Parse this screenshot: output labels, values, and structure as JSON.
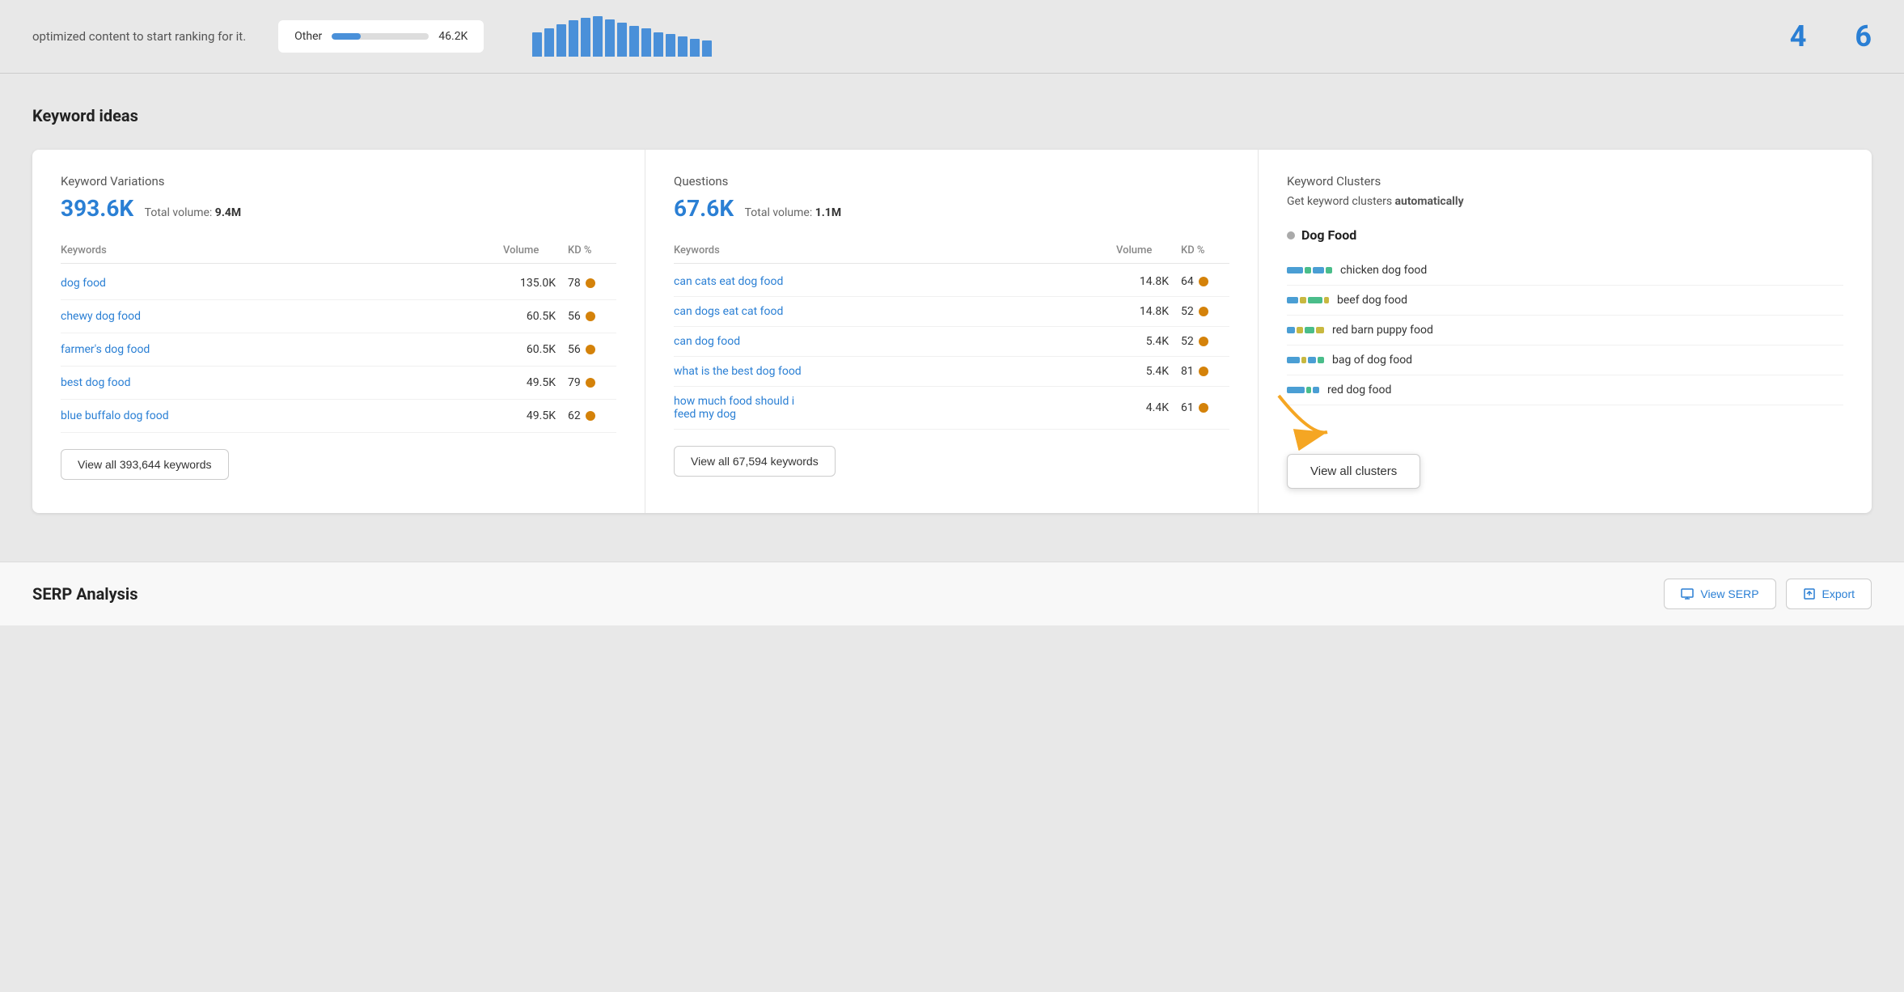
{
  "topBar": {
    "text": "optimized content to start ranking for it.",
    "other": {
      "label": "Other",
      "value": "46.2K",
      "progressPercent": 30
    },
    "chartBars": [
      60,
      70,
      75,
      80,
      85,
      90,
      88,
      82,
      78,
      72,
      65,
      60,
      55,
      50,
      45
    ],
    "numbers": [
      "4",
      "6"
    ]
  },
  "keywordIdeas": {
    "title": "Keyword ideas",
    "variations": {
      "subtitle": "Keyword Variations",
      "count": "393.6K",
      "totalVolumeLabel": "Total volume:",
      "totalVolume": "9.4M",
      "tableHeaders": [
        "Keywords",
        "Volume",
        "KD %"
      ],
      "rows": [
        {
          "keyword": "dog food",
          "volume": "135.0K",
          "kd": "78"
        },
        {
          "keyword": "chewy dog food",
          "volume": "60.5K",
          "kd": "56"
        },
        {
          "keyword": "farmer's dog food",
          "volume": "60.5K",
          "kd": "56"
        },
        {
          "keyword": "best dog food",
          "volume": "49.5K",
          "kd": "79"
        },
        {
          "keyword": "blue buffalo dog food",
          "volume": "49.5K",
          "kd": "62"
        }
      ],
      "viewAllLabel": "View all 393,644 keywords"
    },
    "questions": {
      "subtitle": "Questions",
      "count": "67.6K",
      "totalVolumeLabel": "Total volume:",
      "totalVolume": "1.1M",
      "tableHeaders": [
        "Keywords",
        "Volume",
        "KD %"
      ],
      "rows": [
        {
          "keyword": "can cats eat dog food",
          "volume": "14.8K",
          "kd": "64",
          "multiline": false
        },
        {
          "keyword": "can dogs eat cat food",
          "volume": "14.8K",
          "kd": "52",
          "multiline": false
        },
        {
          "keyword": "can dog food",
          "volume": "5.4K",
          "kd": "52",
          "multiline": false
        },
        {
          "keyword": "what is the best dog food",
          "volume": "5.4K",
          "kd": "81",
          "multiline": false
        },
        {
          "keyword": "how much food should i feed my dog",
          "volume": "4.4K",
          "kd": "61",
          "multiline": true,
          "line1": "how much food should i",
          "line2": "feed my dog"
        }
      ],
      "viewAllLabel": "View all 67,594 keywords"
    },
    "clusters": {
      "subtitle": "Keyword Clusters",
      "autoText": "Get keyword clusters automatically",
      "groupTitle": "Dog Food",
      "items": [
        {
          "label": "chicken dog food",
          "bars": [
            {
              "color": "#4a9ed4",
              "width": 20
            },
            {
              "color": "#4abd8a",
              "width": 8
            },
            {
              "color": "#4a9ed4",
              "width": 14
            },
            {
              "color": "#4abd8a",
              "width": 8
            }
          ]
        },
        {
          "label": "beef dog food",
          "bars": [
            {
              "color": "#4a9ed4",
              "width": 14
            },
            {
              "color": "#c8b840",
              "width": 8
            },
            {
              "color": "#4abd8a",
              "width": 18
            },
            {
              "color": "#c8b840",
              "width": 6
            }
          ]
        },
        {
          "label": "red barn puppy food",
          "bars": [
            {
              "color": "#4a9ed4",
              "width": 10
            },
            {
              "color": "#c8b840",
              "width": 8
            },
            {
              "color": "#4abd8a",
              "width": 12
            },
            {
              "color": "#c8b840",
              "width": 10
            }
          ]
        },
        {
          "label": "bag of dog food",
          "bars": [
            {
              "color": "#4a9ed4",
              "width": 16
            },
            {
              "color": "#c8b840",
              "width": 6
            },
            {
              "color": "#4a9ed4",
              "width": 10
            },
            {
              "color": "#4abd8a",
              "width": 8
            }
          ]
        },
        {
          "label": "red dog food",
          "bars": [
            {
              "color": "#4a9ed4",
              "width": 22
            },
            {
              "color": "#4abd8a",
              "width": 6
            },
            {
              "color": "#4a9ed4",
              "width": 8
            }
          ]
        }
      ],
      "viewAllLabel": "View all clusters"
    }
  },
  "serpAnalysis": {
    "title": "SERP Analysis",
    "viewSerpLabel": "View SERP",
    "exportLabel": "Export"
  }
}
